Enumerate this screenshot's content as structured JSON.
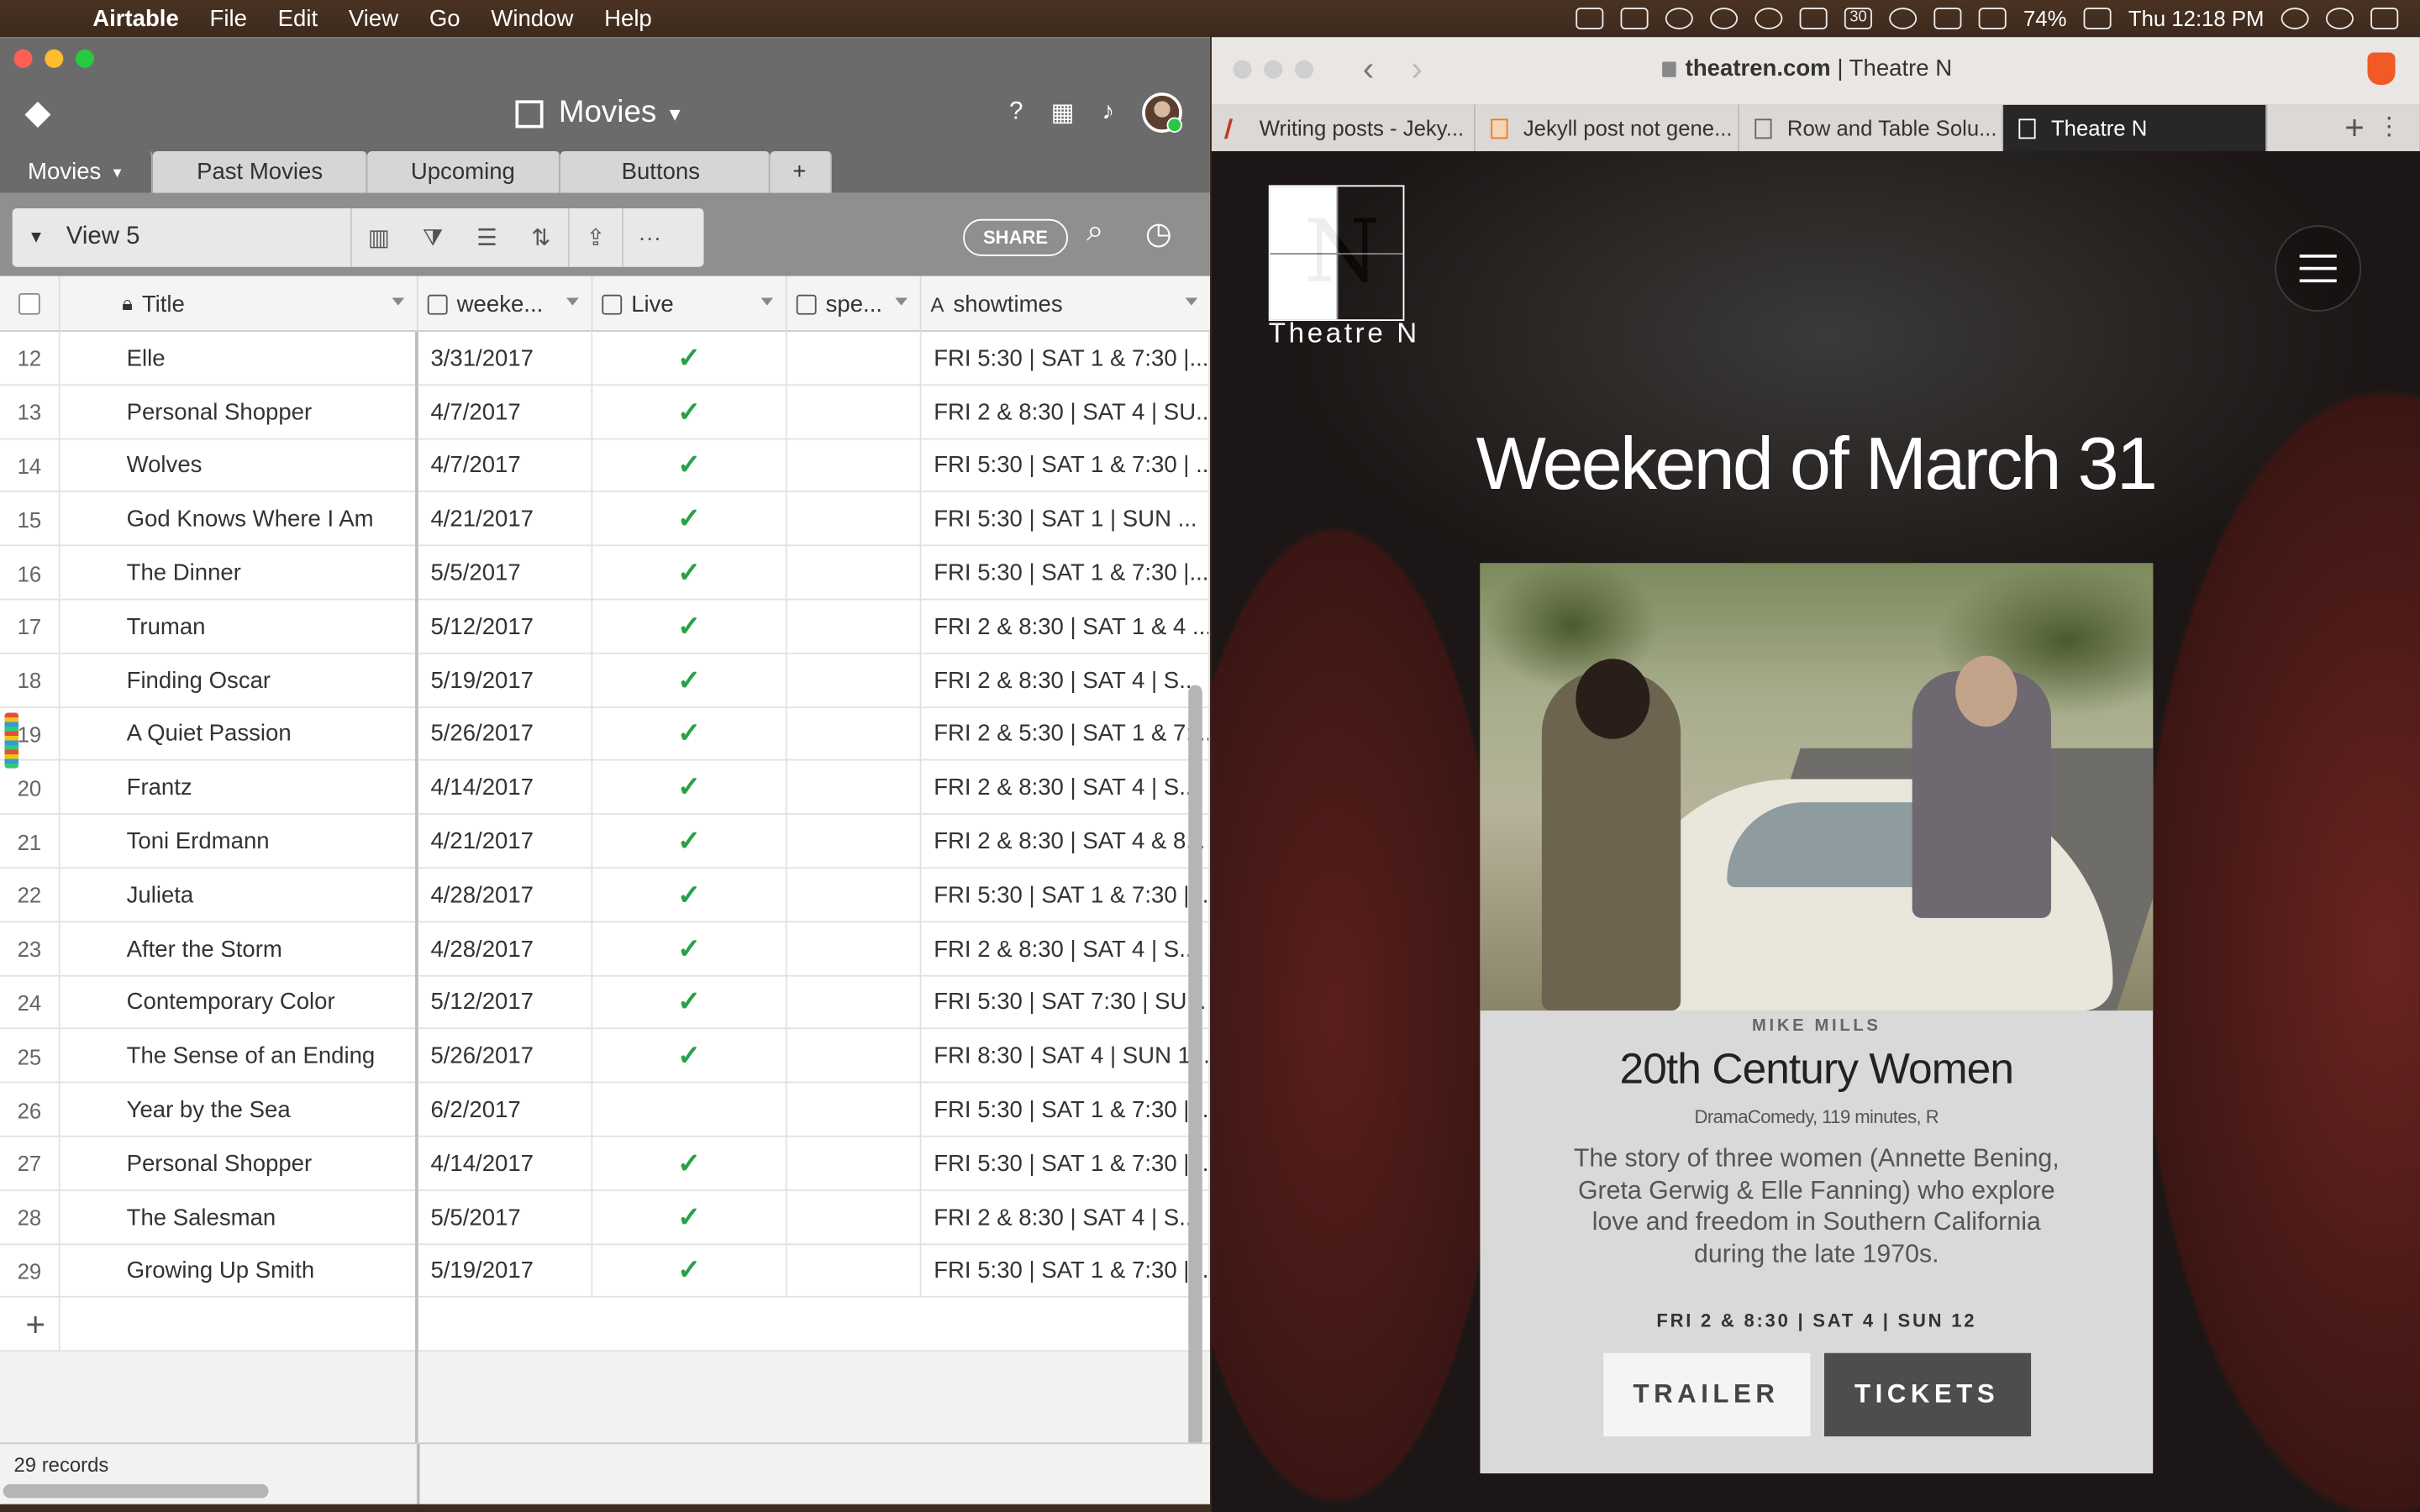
{
  "menubar": {
    "app": "Airtable",
    "items": [
      "File",
      "Edit",
      "View",
      "Go",
      "Window",
      "Help"
    ],
    "calendar_day": "30",
    "battery": "74%",
    "clock": "Thu 12:18 PM"
  },
  "airtable": {
    "base_title": "Movies",
    "tabs": [
      "Movies",
      "Past Movies",
      "Upcoming",
      "Buttons"
    ],
    "add_tab": "+",
    "view_name": "View 5",
    "share_label": "SHARE",
    "columns": [
      "Title",
      "weeke...",
      "Live",
      "spe...",
      "showtimes"
    ],
    "rows": [
      {
        "num": "12",
        "title": "Elle",
        "week": "3/31/2017",
        "live": "✓",
        "show": "FRI 5:30 |  SAT 1 & 7:30 |..."
      },
      {
        "num": "13",
        "title": "Personal Shopper",
        "week": "4/7/2017",
        "live": "✓",
        "show": "FRI 2 & 8:30 | SAT 4 | SU..."
      },
      {
        "num": "14",
        "title": "Wolves",
        "week": "4/7/2017",
        "live": "✓",
        "show": "FRI 5:30 | SAT 1 & 7:30 | ..."
      },
      {
        "num": "15",
        "title": "God Knows Where I Am",
        "week": "4/21/2017",
        "live": "✓",
        "show": "FRI 5:30 |  SAT 1  | SUN ..."
      },
      {
        "num": "16",
        "title": "The Dinner",
        "week": "5/5/2017",
        "live": "✓",
        "show": "FRI 5:30 |  SAT 1 & 7:30 |..."
      },
      {
        "num": "17",
        "title": "Truman",
        "week": "5/12/2017",
        "live": "✓",
        "show": "FRI 2 & 8:30 |  SAT 1 & 4 ..."
      },
      {
        "num": "18",
        "title": "Finding Oscar",
        "week": "5/19/2017",
        "live": "✓",
        "show": "FRI 2 & 8:30 |  SAT 4 | S..."
      },
      {
        "num": "19",
        "title": "A Quiet Passion",
        "week": "5/26/2017",
        "live": "✓",
        "show": "FRI 2 & 5:30 |  SAT 1 & 7:..."
      },
      {
        "num": "20",
        "title": "Frantz",
        "week": "4/14/2017",
        "live": "✓",
        "show": "FRI 2 & 8:30 |  SAT 4 | S..."
      },
      {
        "num": "21",
        "title": "Toni Erdmann",
        "week": "4/21/2017",
        "live": "✓",
        "show": "FRI 2 & 8:30 |  SAT 4 & 8..."
      },
      {
        "num": "22",
        "title": "Julieta",
        "week": "4/28/2017",
        "live": "✓",
        "show": "FRI 5:30 |  SAT 1 & 7:30 |..."
      },
      {
        "num": "23",
        "title": "After the Storm",
        "week": "4/28/2017",
        "live": "✓",
        "show": "FRI 2 & 8:30 |  SAT 4 | S..."
      },
      {
        "num": "24",
        "title": "Contemporary Color",
        "week": "5/12/2017",
        "live": "✓",
        "show": "FRI 5:30 |  SAT 7:30 | SU..."
      },
      {
        "num": "25",
        "title": "The Sense of an Ending",
        "week": "5/26/2017",
        "live": "✓",
        "show": "FRI 8:30 |  SAT 4 | SUN 1..."
      },
      {
        "num": "26",
        "title": "Year by the Sea",
        "week": "6/2/2017",
        "live": "",
        "show": "FRI 5:30 |  SAT 1 & 7:30 |..."
      },
      {
        "num": "27",
        "title": "Personal Shopper",
        "week": "4/14/2017",
        "live": "✓",
        "show": "FRI 5:30 | SAT 1 & 7:30 | ..."
      },
      {
        "num": "28",
        "title": "The Salesman",
        "week": "5/5/2017",
        "live": "✓",
        "show": "FRI 2 & 8:30 |  SAT 4 | S..."
      },
      {
        "num": "29",
        "title": "Growing Up Smith",
        "week": "5/19/2017",
        "live": "✓",
        "show": "FRI 5:30 |  SAT 1 & 7:30 |..."
      }
    ],
    "add_row": "+",
    "records_count": "29 records"
  },
  "browser": {
    "url_domain": "theatren.com",
    "url_title": " | Theatre N",
    "tabs": [
      "Writing posts - Jeky...",
      "Jekyll post not gene...",
      "Row and Table Solu...",
      "Theatre N"
    ],
    "new_tab": "+",
    "page": {
      "logo_text": "Theatre N",
      "logo_letter": "N",
      "headline": "Weekend of March 31",
      "director": "MIKE MILLS",
      "film_title": "20th Century Women",
      "film_meta": "DramaComedy, 119 minutes, R",
      "film_desc": "The story of three women (Annette Bening, Greta Gerwig & Elle Fanning) who explore love and freedom in Southern California during the late 1970s.",
      "showtimes": "FRI 2 & 8:30 | SAT 4 | SUN 12",
      "trailer_label": "TRAILER",
      "tickets_label": "TICKETS"
    }
  }
}
